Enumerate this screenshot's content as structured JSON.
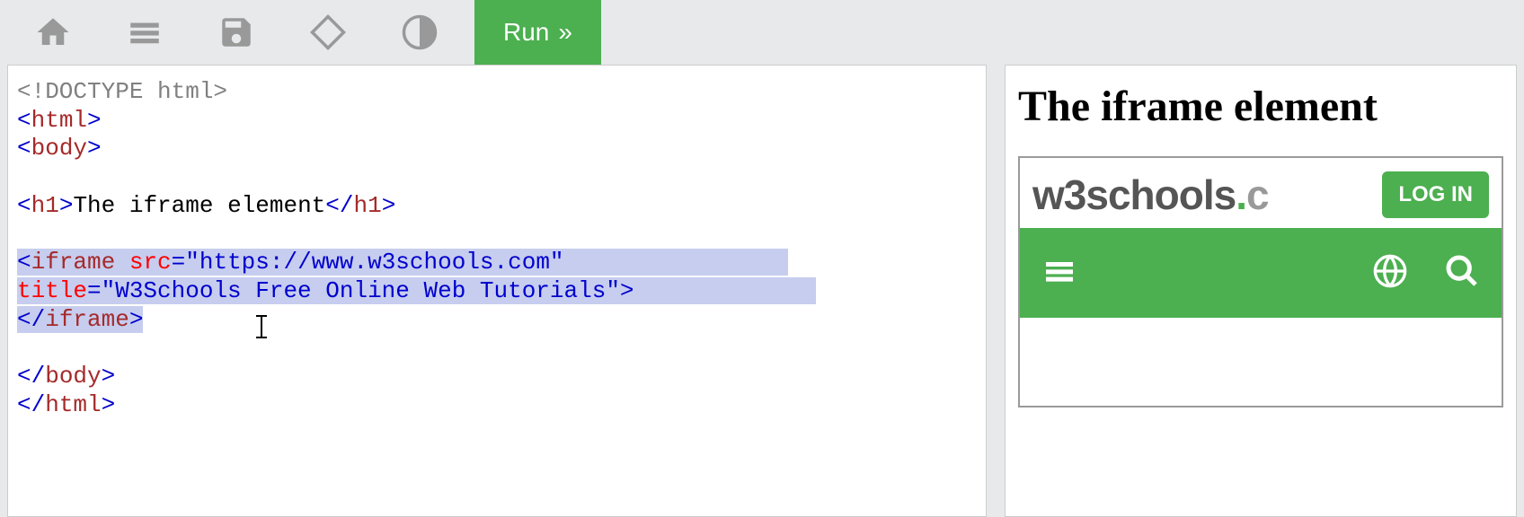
{
  "toolbar": {
    "run_label": "Run"
  },
  "code": {
    "line1": "<!DOCTYPE html>",
    "line2a": "<",
    "line2b": "html",
    "line2c": ">",
    "line3a": "<",
    "line3b": "body",
    "line3c": ">",
    "line5a": "<",
    "line5b": "h1",
    "line5c": ">",
    "line5d": "The iframe element",
    "line5e": "</",
    "line5f": "h1",
    "line5g": ">",
    "line7a": "<",
    "line7b": "iframe",
    "line7sp": " ",
    "line7c": "src",
    "line7d": "=",
    "line7e": "\"https://www.w3schools.com\"",
    "line8a": "title",
    "line8b": "=",
    "line8c": "\"W3Schools Free Online Web Tutorials\"",
    "line8d": ">",
    "line9a": "</",
    "line9b": "iframe",
    "line9c": ">",
    "line11a": "</",
    "line11b": "body",
    "line11c": ">",
    "line12a": "</",
    "line12b": "html",
    "line12c": ">"
  },
  "result": {
    "heading": "The iframe element",
    "logo_w3": "w3",
    "logo_schools": "schools",
    "logo_dot": ".",
    "logo_c": "c",
    "login_label": "LOG IN"
  }
}
